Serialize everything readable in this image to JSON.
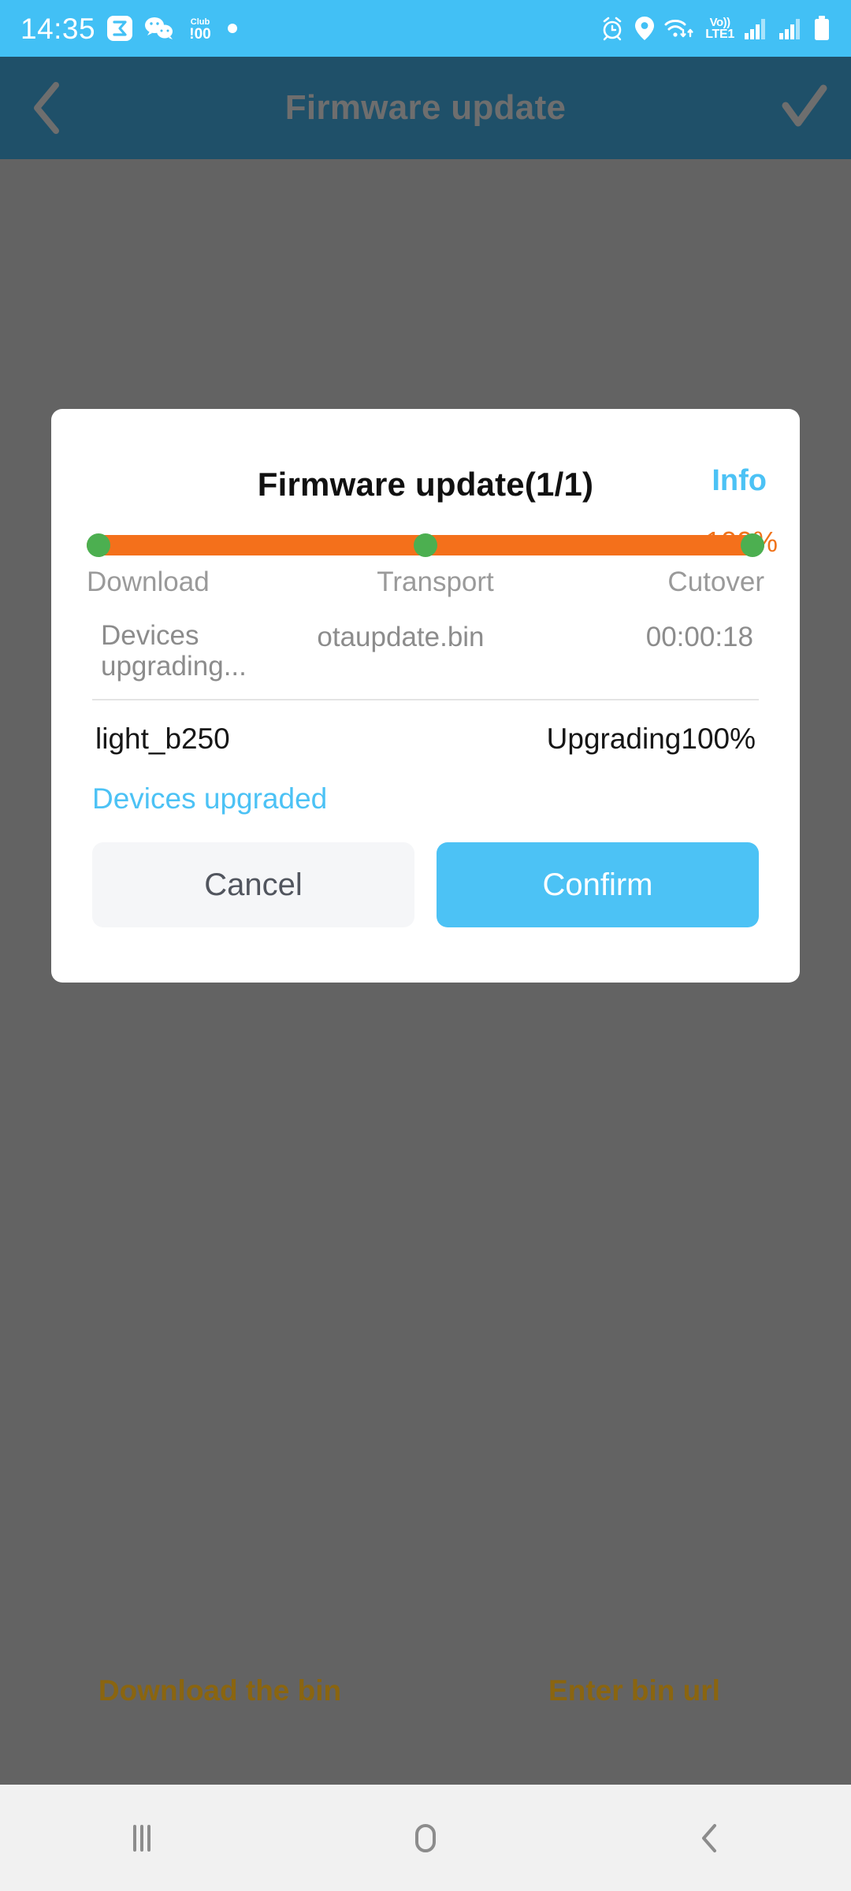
{
  "status_bar": {
    "clock": "14:35",
    "notification_icons": [
      "sigma-app-icon",
      "wechat-icon",
      "club100-icon",
      "dot-icon"
    ],
    "right_icons": [
      "alarm-icon",
      "location-pin-icon",
      "wifi-icon"
    ],
    "volte_top": "Vo))",
    "volte_bottom": "LTE1",
    "signal_icons": [
      "signal-bars-sim1-icon",
      "signal-bars-sim2-icon"
    ],
    "battery_icon": "battery-icon",
    "bg_color": "#42C0F5"
  },
  "app_header": {
    "back_icon": "chevron-left-icon",
    "title": "Firmware update",
    "confirm_icon": "check-icon",
    "bg_color": "#1F5069",
    "title_color": "#6E6E6E"
  },
  "dialog": {
    "title": "Firmware update(1/1)",
    "info_label": "Info",
    "info_color": "#4CC2F5",
    "progress": {
      "percent_label": "100%",
      "percent_value": 100,
      "bar_color": "#F4701B",
      "marker_color": "#4CAF50",
      "steps": [
        {
          "label": "Download",
          "position": 0
        },
        {
          "label": "Transport",
          "position": 50
        },
        {
          "label": "Cutover",
          "position": 100
        }
      ]
    },
    "meta": {
      "status": "Devices upgrading...",
      "file_name": "otaupdate.bin",
      "elapsed": "00:00:18"
    },
    "device_list": [
      {
        "name": "light_b250",
        "status": "Upgrading100%"
      }
    ],
    "upgraded_note": "Devices upgraded",
    "buttons": {
      "cancel": "Cancel",
      "confirm": "Confirm",
      "confirm_color": "#4CC2F5",
      "cancel_color": "#F5F6F8"
    }
  },
  "bottom_links": {
    "download_bin": "Download the bin",
    "enter_url": "Enter bin url",
    "color": "#8A6510"
  },
  "nav_bar": {
    "recents_icon": "recents-icon",
    "home_icon": "home-icon",
    "back_icon": "back-chevron-icon",
    "bg_color": "#F1F1F1"
  }
}
